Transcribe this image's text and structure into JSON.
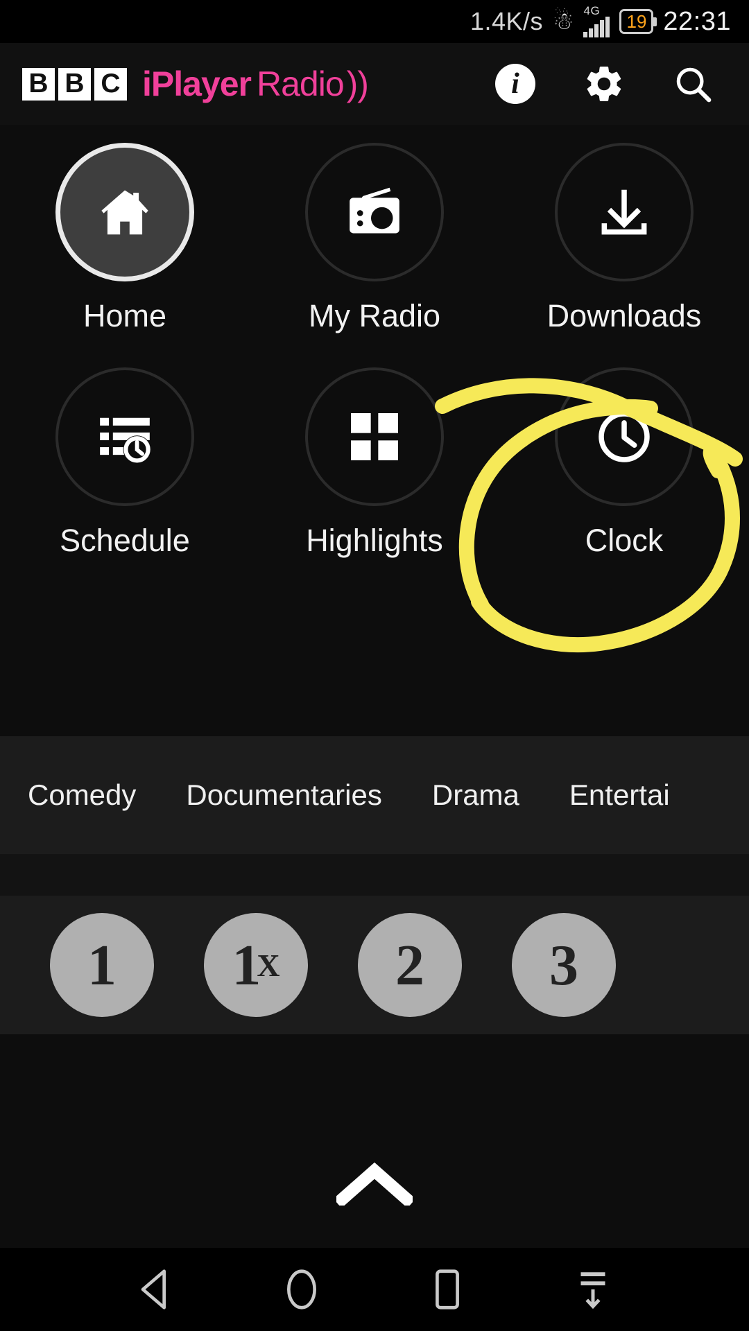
{
  "statusbar": {
    "network_speed": "1.4K/s",
    "bluetooth_icon": "bluetooth-icon",
    "network_type": "4G",
    "battery_level": "19",
    "battery_color": "#ffa41b",
    "time": "22:31"
  },
  "appbar": {
    "brand_blocks": [
      "B",
      "B",
      "C"
    ],
    "brand_iplayer": "iPlayer",
    "brand_radio": "Radio",
    "brand_color": "#f0409a",
    "actions": [
      {
        "name": "info-icon",
        "label": "i"
      },
      {
        "name": "gear-icon",
        "label": ""
      },
      {
        "name": "search-icon",
        "label": ""
      }
    ]
  },
  "navgrid": {
    "row1": [
      {
        "label": "Home",
        "icon": "home-icon",
        "selected": true
      },
      {
        "label": "My Radio",
        "icon": "radio-icon",
        "selected": false
      },
      {
        "label": "Downloads",
        "icon": "download-icon",
        "selected": false
      }
    ],
    "row2": [
      {
        "label": "Schedule",
        "icon": "schedule-clock-icon",
        "selected": false
      },
      {
        "label": "Highlights",
        "icon": "grid-icon",
        "selected": false
      },
      {
        "label": "Clock",
        "icon": "clock-icon",
        "selected": false
      }
    ]
  },
  "genres": [
    "Comedy",
    "Documentaries",
    "Drama",
    "Entertai"
  ],
  "stations": [
    {
      "label": "1",
      "sup": ""
    },
    {
      "label": "1",
      "sup": "X"
    },
    {
      "label": "2",
      "sup": ""
    },
    {
      "label": "3",
      "sup": ""
    }
  ],
  "lower": {
    "expand_icon": "chevron-up-icon"
  },
  "navbar": {
    "buttons": [
      {
        "name": "back-button",
        "icon": "back-triangle-icon"
      },
      {
        "name": "home-button",
        "icon": "home-circle-icon"
      },
      {
        "name": "recents-button",
        "icon": "recents-square-icon"
      },
      {
        "name": "notification-pull-button",
        "icon": "pull-down-icon"
      }
    ]
  },
  "annotation": {
    "color": "#f6e958",
    "shape": "hand-drawn-circle-around-clock"
  }
}
